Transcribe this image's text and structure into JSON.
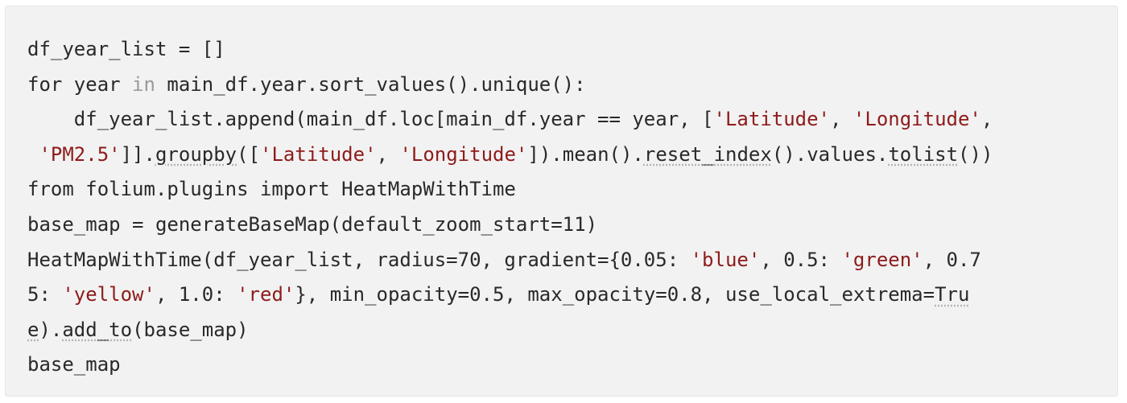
{
  "code_block": {
    "language": "python",
    "lines": [
      [
        {
          "t": "df_year_list = []",
          "k": "plain"
        }
      ],
      [
        {
          "t": "for year ",
          "k": "plain"
        },
        {
          "t": "in",
          "k": "kw"
        },
        {
          "t": " main_df.year.sort_values().unique():",
          "k": "plain"
        }
      ],
      [
        {
          "t": "    df_year_list.append(main_df.loc[main_df.year == year, [",
          "k": "plain"
        },
        {
          "t": "'Latitude'",
          "k": "str"
        },
        {
          "t": ", ",
          "k": "plain"
        },
        {
          "t": "'Longitude'",
          "k": "str"
        },
        {
          "t": ",",
          "k": "plain"
        }
      ],
      [
        {
          "t": " ",
          "k": "plain"
        },
        {
          "t": "'PM2.5'",
          "k": "str"
        },
        {
          "t": "]].",
          "k": "plain"
        },
        {
          "t": "groupby",
          "k": "und"
        },
        {
          "t": "([",
          "k": "plain"
        },
        {
          "t": "'Latitude'",
          "k": "str"
        },
        {
          "t": ", ",
          "k": "plain"
        },
        {
          "t": "'Longitude'",
          "k": "str"
        },
        {
          "t": "]).mean().",
          "k": "plain"
        },
        {
          "t": "reset_index",
          "k": "und"
        },
        {
          "t": "().values.",
          "k": "plain"
        },
        {
          "t": "tolist",
          "k": "und"
        },
        {
          "t": "())",
          "k": "plain"
        }
      ],
      [
        {
          "t": "from folium.plugins import HeatMapWithTime",
          "k": "plain"
        }
      ],
      [
        {
          "t": "base_map = generateBaseMap(default_zoom_start=11)",
          "k": "plain"
        }
      ],
      [
        {
          "t": "HeatMapWithTime(df_year_list, radius=70, gradient={0.05: ",
          "k": "plain"
        },
        {
          "t": "'blue'",
          "k": "str"
        },
        {
          "t": ", 0.5: ",
          "k": "plain"
        },
        {
          "t": "'green'",
          "k": "str"
        },
        {
          "t": ", 0.7",
          "k": "plain"
        }
      ],
      [
        {
          "t": "5: ",
          "k": "plain"
        },
        {
          "t": "'yellow'",
          "k": "str"
        },
        {
          "t": ", 1.0: ",
          "k": "plain"
        },
        {
          "t": "'red'",
          "k": "str"
        },
        {
          "t": "}, min_opacity=0.5, max_opacity=0.8, use_local_extrema=",
          "k": "plain"
        },
        {
          "t": "Tru",
          "k": "und"
        }
      ],
      [
        {
          "t": "e",
          "k": "und"
        },
        {
          "t": ").",
          "k": "plain"
        },
        {
          "t": "add_to",
          "k": "und"
        },
        {
          "t": "(base_map)",
          "k": "plain"
        }
      ],
      [
        {
          "t": "base_map",
          "k": "plain"
        }
      ]
    ]
  }
}
